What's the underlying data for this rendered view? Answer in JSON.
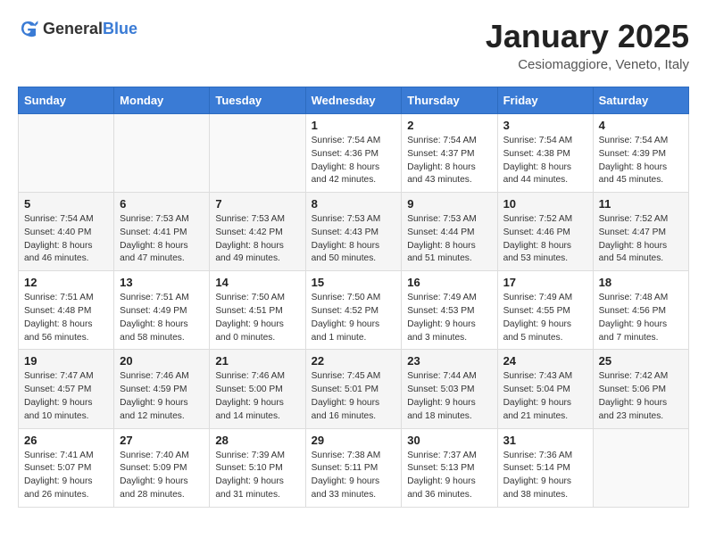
{
  "header": {
    "logo_general": "General",
    "logo_blue": "Blue",
    "title": "January 2025",
    "subtitle": "Cesiomaggiore, Veneto, Italy"
  },
  "weekdays": [
    "Sunday",
    "Monday",
    "Tuesday",
    "Wednesday",
    "Thursday",
    "Friday",
    "Saturday"
  ],
  "weeks": [
    [
      {
        "day": "",
        "info": ""
      },
      {
        "day": "",
        "info": ""
      },
      {
        "day": "",
        "info": ""
      },
      {
        "day": "1",
        "info": "Sunrise: 7:54 AM\nSunset: 4:36 PM\nDaylight: 8 hours\nand 42 minutes."
      },
      {
        "day": "2",
        "info": "Sunrise: 7:54 AM\nSunset: 4:37 PM\nDaylight: 8 hours\nand 43 minutes."
      },
      {
        "day": "3",
        "info": "Sunrise: 7:54 AM\nSunset: 4:38 PM\nDaylight: 8 hours\nand 44 minutes."
      },
      {
        "day": "4",
        "info": "Sunrise: 7:54 AM\nSunset: 4:39 PM\nDaylight: 8 hours\nand 45 minutes."
      }
    ],
    [
      {
        "day": "5",
        "info": "Sunrise: 7:54 AM\nSunset: 4:40 PM\nDaylight: 8 hours\nand 46 minutes."
      },
      {
        "day": "6",
        "info": "Sunrise: 7:53 AM\nSunset: 4:41 PM\nDaylight: 8 hours\nand 47 minutes."
      },
      {
        "day": "7",
        "info": "Sunrise: 7:53 AM\nSunset: 4:42 PM\nDaylight: 8 hours\nand 49 minutes."
      },
      {
        "day": "8",
        "info": "Sunrise: 7:53 AM\nSunset: 4:43 PM\nDaylight: 8 hours\nand 50 minutes."
      },
      {
        "day": "9",
        "info": "Sunrise: 7:53 AM\nSunset: 4:44 PM\nDaylight: 8 hours\nand 51 minutes."
      },
      {
        "day": "10",
        "info": "Sunrise: 7:52 AM\nSunset: 4:46 PM\nDaylight: 8 hours\nand 53 minutes."
      },
      {
        "day": "11",
        "info": "Sunrise: 7:52 AM\nSunset: 4:47 PM\nDaylight: 8 hours\nand 54 minutes."
      }
    ],
    [
      {
        "day": "12",
        "info": "Sunrise: 7:51 AM\nSunset: 4:48 PM\nDaylight: 8 hours\nand 56 minutes."
      },
      {
        "day": "13",
        "info": "Sunrise: 7:51 AM\nSunset: 4:49 PM\nDaylight: 8 hours\nand 58 minutes."
      },
      {
        "day": "14",
        "info": "Sunrise: 7:50 AM\nSunset: 4:51 PM\nDaylight: 9 hours\nand 0 minutes."
      },
      {
        "day": "15",
        "info": "Sunrise: 7:50 AM\nSunset: 4:52 PM\nDaylight: 9 hours\nand 1 minute."
      },
      {
        "day": "16",
        "info": "Sunrise: 7:49 AM\nSunset: 4:53 PM\nDaylight: 9 hours\nand 3 minutes."
      },
      {
        "day": "17",
        "info": "Sunrise: 7:49 AM\nSunset: 4:55 PM\nDaylight: 9 hours\nand 5 minutes."
      },
      {
        "day": "18",
        "info": "Sunrise: 7:48 AM\nSunset: 4:56 PM\nDaylight: 9 hours\nand 7 minutes."
      }
    ],
    [
      {
        "day": "19",
        "info": "Sunrise: 7:47 AM\nSunset: 4:57 PM\nDaylight: 9 hours\nand 10 minutes."
      },
      {
        "day": "20",
        "info": "Sunrise: 7:46 AM\nSunset: 4:59 PM\nDaylight: 9 hours\nand 12 minutes."
      },
      {
        "day": "21",
        "info": "Sunrise: 7:46 AM\nSunset: 5:00 PM\nDaylight: 9 hours\nand 14 minutes."
      },
      {
        "day": "22",
        "info": "Sunrise: 7:45 AM\nSunset: 5:01 PM\nDaylight: 9 hours\nand 16 minutes."
      },
      {
        "day": "23",
        "info": "Sunrise: 7:44 AM\nSunset: 5:03 PM\nDaylight: 9 hours\nand 18 minutes."
      },
      {
        "day": "24",
        "info": "Sunrise: 7:43 AM\nSunset: 5:04 PM\nDaylight: 9 hours\nand 21 minutes."
      },
      {
        "day": "25",
        "info": "Sunrise: 7:42 AM\nSunset: 5:06 PM\nDaylight: 9 hours\nand 23 minutes."
      }
    ],
    [
      {
        "day": "26",
        "info": "Sunrise: 7:41 AM\nSunset: 5:07 PM\nDaylight: 9 hours\nand 26 minutes."
      },
      {
        "day": "27",
        "info": "Sunrise: 7:40 AM\nSunset: 5:09 PM\nDaylight: 9 hours\nand 28 minutes."
      },
      {
        "day": "28",
        "info": "Sunrise: 7:39 AM\nSunset: 5:10 PM\nDaylight: 9 hours\nand 31 minutes."
      },
      {
        "day": "29",
        "info": "Sunrise: 7:38 AM\nSunset: 5:11 PM\nDaylight: 9 hours\nand 33 minutes."
      },
      {
        "day": "30",
        "info": "Sunrise: 7:37 AM\nSunset: 5:13 PM\nDaylight: 9 hours\nand 36 minutes."
      },
      {
        "day": "31",
        "info": "Sunrise: 7:36 AM\nSunset: 5:14 PM\nDaylight: 9 hours\nand 38 minutes."
      },
      {
        "day": "",
        "info": ""
      }
    ]
  ]
}
